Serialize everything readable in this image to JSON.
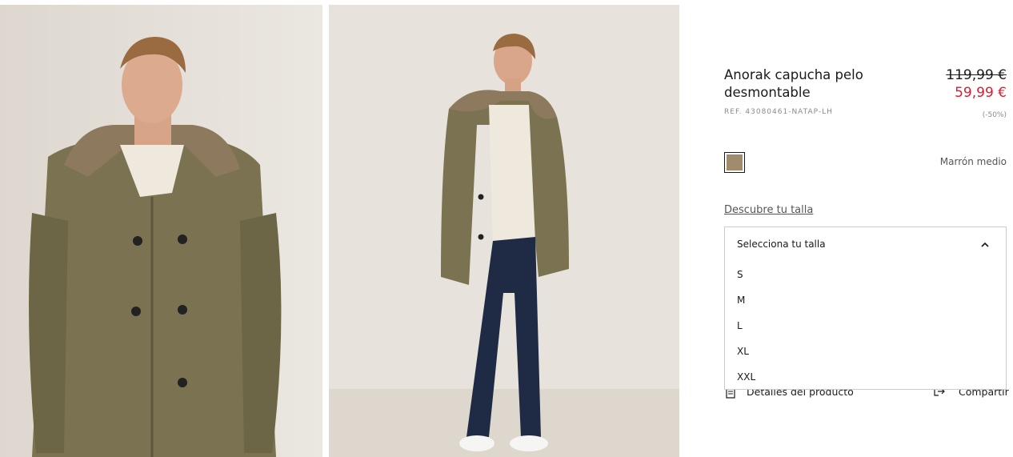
{
  "product": {
    "title": "Anorak capucha pelo desmontable",
    "ref": "REF. 43080461-NATAP-LH",
    "price_old": "119,99 €",
    "price_new": "59,99 €",
    "discount": "(-50%)"
  },
  "color": {
    "name": "Marrón medio",
    "swatch_hex": "#a08c6c"
  },
  "size_guide_label": "Descubre tu talla",
  "size_select": {
    "label": "Selecciona tu talla",
    "options": [
      "S",
      "M",
      "L",
      "XL",
      "XXL"
    ]
  },
  "actions": {
    "details_label": "Detalles del producto",
    "share_label": "Compartir"
  },
  "icons": {
    "details": "document-icon",
    "share": "share-icon",
    "select": "chevron-up-icon"
  },
  "colors": {
    "sale_price": "#e0192c",
    "text": "#1a1a1a",
    "muted": "#8a8a8a"
  }
}
